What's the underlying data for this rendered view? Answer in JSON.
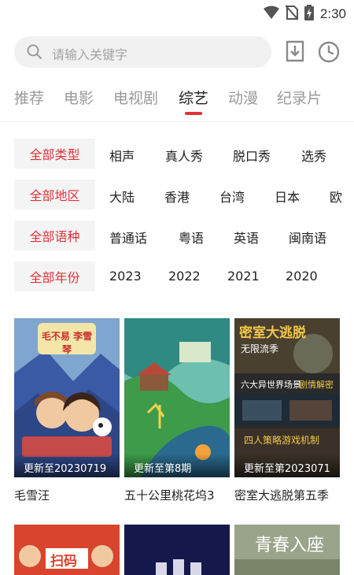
{
  "status_bar": {
    "time": "2:30"
  },
  "search": {
    "placeholder": "请输入关键字"
  },
  "tabs": [
    {
      "label": "推荐"
    },
    {
      "label": "电影"
    },
    {
      "label": "电视剧"
    },
    {
      "label": "综艺",
      "active": true
    },
    {
      "label": "动漫"
    },
    {
      "label": "纪录片"
    }
  ],
  "filters": {
    "type": {
      "selected": "全部类型",
      "options": [
        "相声",
        "真人秀",
        "脱口秀",
        "选秀"
      ]
    },
    "region": {
      "selected": "全部地区",
      "options": [
        "大陆",
        "香港",
        "台湾",
        "日本",
        "欧"
      ]
    },
    "language": {
      "selected": "全部语种",
      "options": [
        "普通话",
        "粤语",
        "英语",
        "闽南语"
      ]
    },
    "year": {
      "selected": "全部年份",
      "options": [
        "2023",
        "2022",
        "2021",
        "2020"
      ]
    }
  },
  "cards": [
    {
      "badge": "更新至20230719",
      "title": "毛雪汪",
      "poster_text": [
        "毛不易 李雪琴"
      ]
    },
    {
      "badge": "更新至第8期",
      "title": "五十公里桃花坞3",
      "poster_text": []
    },
    {
      "badge": "更新至第2023071",
      "title": "密室大逃脱第五季",
      "poster_text": [
        "密室大逃脱",
        "无限流季",
        "六大异世界场景",
        "剧情解密",
        "四人策略游戏机制"
      ]
    }
  ],
  "cards_row2": [
    {
      "poster_text": "扫码"
    },
    {
      "poster_text": ""
    },
    {
      "poster_text": "青春入座"
    }
  ],
  "colors": {
    "accent": "#e0323a"
  }
}
